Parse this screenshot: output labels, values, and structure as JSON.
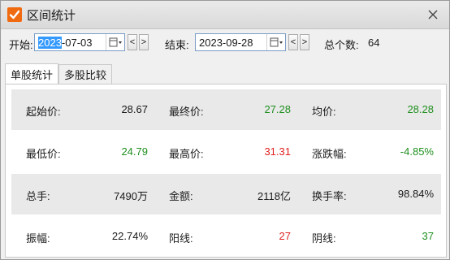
{
  "window": {
    "title": "区间统计",
    "icon": "checkmark-icon",
    "close": "close-icon"
  },
  "toolbar": {
    "start_label": "开始:",
    "start_date_selected": "2023",
    "start_date_rest": "-07-03",
    "end_label": "结束:",
    "end_date": "2023-09-28",
    "prev": "<",
    "next": ">",
    "total_label": "总个数:",
    "total_value": "64"
  },
  "tabs": [
    {
      "label": "单股统计",
      "active": true
    },
    {
      "label": "多股比较",
      "active": false
    }
  ],
  "stats": {
    "open_label": "起始价:",
    "open_value": "28.67",
    "close_label": "最终价:",
    "close_value": "27.28",
    "avg_label": "均价:",
    "avg_value": "28.28",
    "low_label": "最低价:",
    "low_value": "24.79",
    "high_label": "最高价:",
    "high_value": "31.31",
    "change_label": "涨跌幅:",
    "change_value": "-4.85%",
    "vol_label": "总手:",
    "vol_value": "7490万",
    "amount_label": "金额:",
    "amount_value": "2118亿",
    "turnover_label": "换手率:",
    "turnover_value": "98.84%",
    "amp_label": "振幅:",
    "amp_value": "22.74%",
    "up_label": "阳线:",
    "up_value": "27",
    "down_label": "阴线:",
    "down_value": "37"
  },
  "colors": {
    "accent": "#f06a0f",
    "up": "#e02020",
    "down": "#1f8f1f"
  }
}
